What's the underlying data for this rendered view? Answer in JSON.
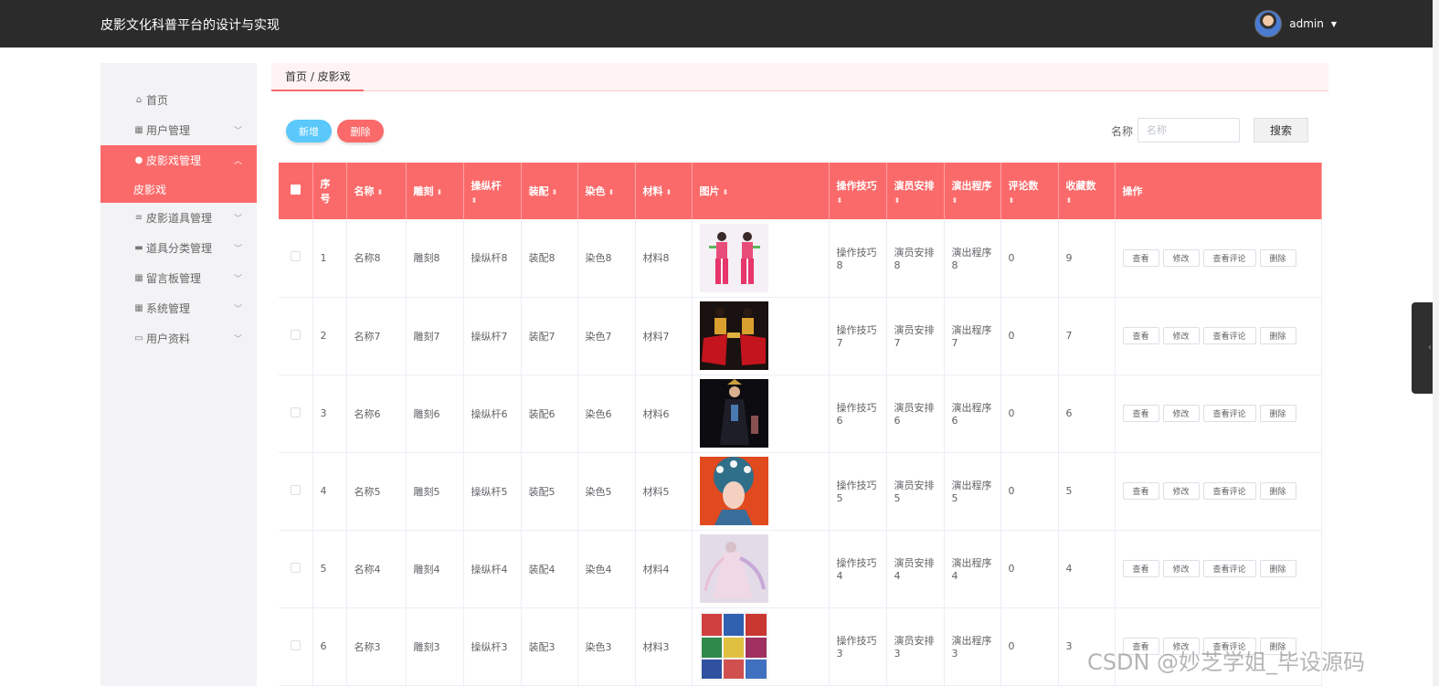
{
  "header": {
    "title": "皮影文化科普平台的设计与实现",
    "user": "admin"
  },
  "sidebar": {
    "items": [
      {
        "label": "首页",
        "icon": "home-icon"
      },
      {
        "label": "用户管理",
        "icon": "grid-icon"
      },
      {
        "label": "皮影戏管理",
        "icon": "user-icon",
        "active": true,
        "sub": [
          "皮影戏"
        ]
      },
      {
        "label": "皮影道具管理",
        "icon": "list-icon"
      },
      {
        "label": "道具分类管理",
        "icon": "chat-icon"
      },
      {
        "label": "留言板管理",
        "icon": "grid-icon"
      },
      {
        "label": "系统管理",
        "icon": "grid-icon"
      },
      {
        "label": "用户资料",
        "icon": "calendar-icon"
      }
    ]
  },
  "breadcrumb": "首页 / 皮影戏",
  "toolbar": {
    "add_label": "新增",
    "delete_label": "删除"
  },
  "search": {
    "label": "名称",
    "placeholder": "名称",
    "button": "搜索"
  },
  "table": {
    "headers": [
      "序号",
      "名称",
      "雕刻",
      "操纵杆",
      "装配",
      "染色",
      "材料",
      "图片",
      "操作技巧",
      "演员安排",
      "演出程序",
      "评论数",
      "收藏数",
      "操作"
    ],
    "actions": [
      "查看",
      "修改",
      "查看评论",
      "删除"
    ],
    "rows": [
      {
        "no": "1",
        "name": "名称8",
        "carve": "雕刻8",
        "rod": "操纵杆8",
        "assembly": "装配8",
        "dye": "染色8",
        "material": "材料8",
        "image": "image-performers-pink",
        "skill": "操作技巧8",
        "actor": "演员安排8",
        "program": "演出程序8",
        "comments": "0",
        "favorites": "9"
      },
      {
        "no": "2",
        "name": "名称7",
        "carve": "雕刻7",
        "rod": "操纵杆7",
        "assembly": "装配7",
        "dye": "染色7",
        "material": "材料7",
        "image": "image-performers-red-gold",
        "skill": "操作技巧7",
        "actor": "演员安排7",
        "program": "演出程序7",
        "comments": "0",
        "favorites": "7"
      },
      {
        "no": "3",
        "name": "名称6",
        "carve": "雕刻6",
        "rod": "操纵杆6",
        "assembly": "装配6",
        "dye": "染色6",
        "material": "材料6",
        "image": "image-performer-black",
        "skill": "操作技巧6",
        "actor": "演员安排6",
        "program": "演出程序6",
        "comments": "0",
        "favorites": "6"
      },
      {
        "no": "4",
        "name": "名称5",
        "carve": "雕刻5",
        "rod": "操纵杆5",
        "assembly": "装配5",
        "dye": "染色5",
        "material": "材料5",
        "image": "image-opera-headdress",
        "skill": "操作技巧5",
        "actor": "演员安排5",
        "program": "演出程序5",
        "comments": "0",
        "favorites": "5"
      },
      {
        "no": "5",
        "name": "名称4",
        "carve": "雕刻4",
        "rod": "操纵杆4",
        "assembly": "装配4",
        "dye": "染色4",
        "material": "材料4",
        "image": "image-dancer-pastel",
        "skill": "操作技巧4",
        "actor": "演员安排4",
        "program": "演出程序4",
        "comments": "0",
        "favorites": "4"
      },
      {
        "no": "6",
        "name": "名称3",
        "carve": "雕刻3",
        "rod": "操纵杆3",
        "assembly": "装配3",
        "dye": "染色3",
        "material": "材料3",
        "image": "image-costume-grid",
        "skill": "操作技巧3",
        "actor": "演员安排3",
        "program": "演出程序3",
        "comments": "0",
        "favorites": "3"
      }
    ]
  },
  "colors": {
    "accent": "#fb6a6a",
    "add_button": "#5ac8fa",
    "topbar": "#2b2b2b",
    "sidebar": "#f3f3f5"
  },
  "watermark": "CSDN @妙芝学姐_毕设源码"
}
